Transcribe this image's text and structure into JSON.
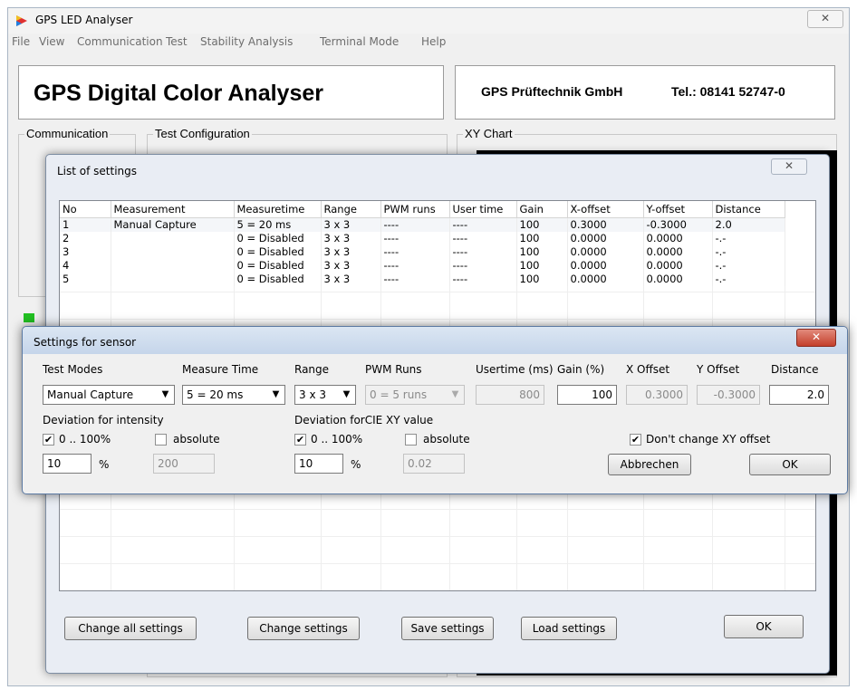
{
  "app": {
    "title": "GPS LED Analyser",
    "close_glyph": "✕"
  },
  "menu": {
    "items": [
      "File",
      "View",
      "Communication",
      "Test",
      "Stability Analysis",
      "Terminal Mode",
      "Help"
    ]
  },
  "header": {
    "title": "GPS Digital Color Analyser",
    "company": "GPS Prüftechnik GmbH",
    "phone": "Tel.: 08141 52747-0"
  },
  "groups": {
    "communication": "Communication",
    "test_configuration": "Test Configuration",
    "xy_chart": "XY Chart"
  },
  "list_window": {
    "title": "List of settings",
    "close_glyph": "✕",
    "columns": [
      "No",
      "Measurement",
      "Measuretime",
      "Range",
      "PWM runs",
      "User time",
      "Gain",
      "X-offset",
      "Y-offset",
      "Distance"
    ],
    "rows": [
      [
        "1",
        "Manual Capture",
        "5 = 20 ms",
        "3 x 3",
        "----",
        "----",
        "100",
        "0.3000",
        "-0.3000",
        "2.0"
      ],
      [
        "2",
        "",
        "0 = Disabled",
        "3 x 3",
        "----",
        "----",
        "100",
        "0.0000",
        "0.0000",
        "-.-"
      ],
      [
        "3",
        "",
        "0 = Disabled",
        "3 x 3",
        "----",
        "----",
        "100",
        "0.0000",
        "0.0000",
        "-.-"
      ],
      [
        "4",
        "",
        "0 = Disabled",
        "3 x 3",
        "----",
        "----",
        "100",
        "0.0000",
        "0.0000",
        "-.-"
      ],
      [
        "5",
        "",
        "0 = Disabled",
        "3 x 3",
        "----",
        "----",
        "100",
        "0.0000",
        "0.0000",
        "-.-"
      ]
    ],
    "buttons": {
      "change_all": "Change all settings",
      "change": "Change settings",
      "save": "Save settings",
      "load": "Load settings",
      "ok": "OK"
    }
  },
  "sensor_dialog": {
    "title": "Settings for sensor",
    "close_glyph": "✕",
    "labels": {
      "test_modes": "Test Modes",
      "measure_time": "Measure Time",
      "range": "Range",
      "pwm_runs": "PWM Runs",
      "usertime": "Usertime (ms)",
      "gain": "Gain (%)",
      "x_offset": "X Offset",
      "y_offset": "Y Offset",
      "distance": "Distance",
      "dev_intensity": "Deviation for intensity",
      "dev_cie": "Deviation forCIE XY value"
    },
    "values": {
      "test_mode": "Manual Capture",
      "measure_time": "5 = 20 ms",
      "range": "3 x 3",
      "pwm_runs": "0 = 5 runs",
      "usertime": "800",
      "gain": "100",
      "x_offset": "0.3000",
      "y_offset": "-0.3000",
      "distance": "2.0"
    },
    "intensity": {
      "percent_label": "0 .. 100%",
      "absolute_label": "absolute",
      "percent_value": "10",
      "unit": "%",
      "absolute_value": "200"
    },
    "cie": {
      "percent_label": "0 .. 100%",
      "absolute_label": "absolute",
      "percent_value": "10",
      "unit": "%",
      "absolute_value": "0.02"
    },
    "dont_change_offset": "Don't change XY offset",
    "buttons": {
      "cancel": "Abbrechen",
      "ok": "OK"
    }
  },
  "colors": {
    "led_green": "#22c022",
    "close_red": "#c4402c"
  }
}
